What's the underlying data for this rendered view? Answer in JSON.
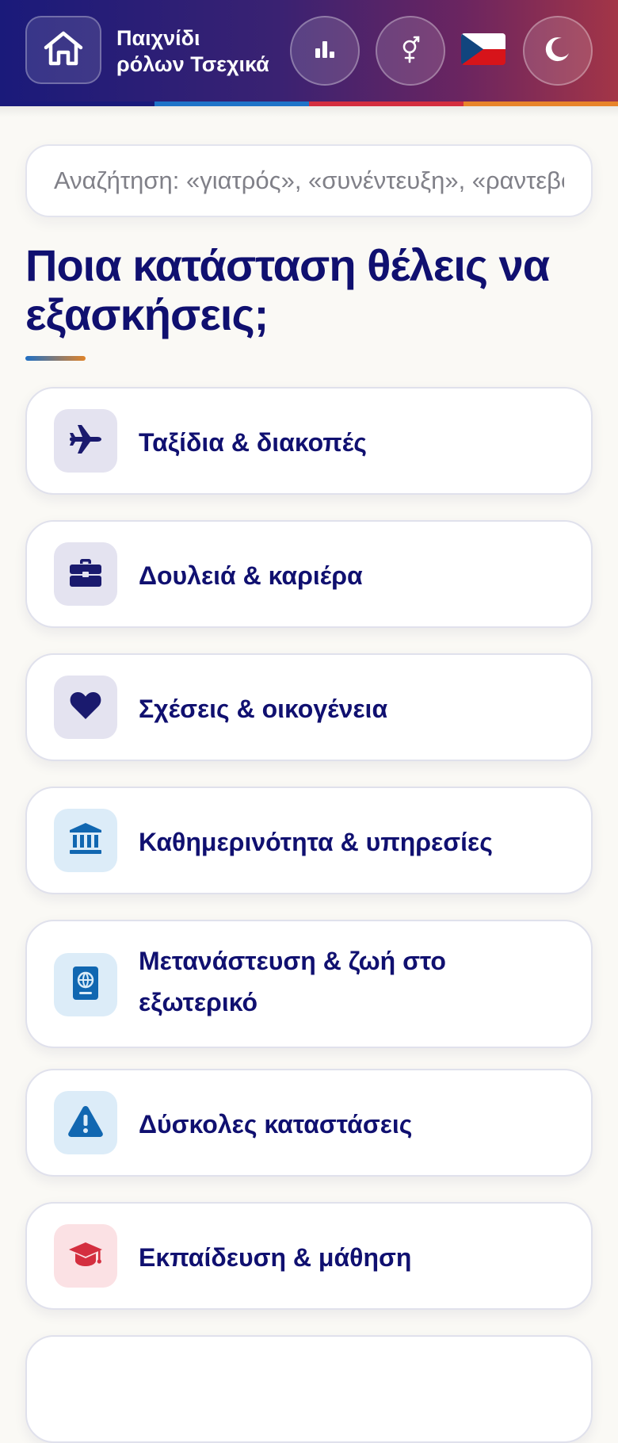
{
  "header": {
    "home_icon": "home-icon",
    "brand_line1": "Παιχνίδι",
    "brand_line2": "ρόλων Τσεχικά",
    "buttons": [
      {
        "name": "stats-button",
        "icon": "bar-chart-icon"
      },
      {
        "name": "gender-button",
        "icon": "gender-icon"
      },
      {
        "name": "language-flag",
        "icon": "czech-flag-icon"
      },
      {
        "name": "theme-button",
        "icon": "moon-icon"
      }
    ],
    "stripe_colors": [
      "#1a1a7a",
      "#1f74c8",
      "#d42e3f",
      "#e8842a"
    ]
  },
  "search": {
    "placeholder": "Αναζήτηση: «γιατρός», «συνέντευξη», «ραντεβού»",
    "value": ""
  },
  "main": {
    "heading": "Ποια κατάσταση θέλεις να εξασκήσεις;",
    "categories": [
      {
        "label": "Ταξίδια & διακοπές",
        "icon": "airplane-icon",
        "tint": "purple"
      },
      {
        "label": "Δουλειά & καριέρα",
        "icon": "briefcase-icon",
        "tint": "purple"
      },
      {
        "label": "Σχέσεις & οικογένεια",
        "icon": "heart-icon",
        "tint": "purple"
      },
      {
        "label": "Καθημερινότητα & υπηρεσίες",
        "icon": "bank-icon",
        "tint": "blue"
      },
      {
        "label": "Μετανάστευση & ζωή στο εξωτερικό",
        "icon": "passport-icon",
        "tint": "blue"
      },
      {
        "label": "Δύσκολες καταστάσεις",
        "icon": "warning-icon",
        "tint": "blue"
      },
      {
        "label": "Εκπαίδευση & μάθηση",
        "icon": "graduation-cap-icon",
        "tint": "red"
      }
    ]
  },
  "colors": {
    "primary_text": "#101070",
    "accent_blue": "#1167b1",
    "accent_red": "#d42e3f",
    "page_bg": "#faf9f5"
  }
}
